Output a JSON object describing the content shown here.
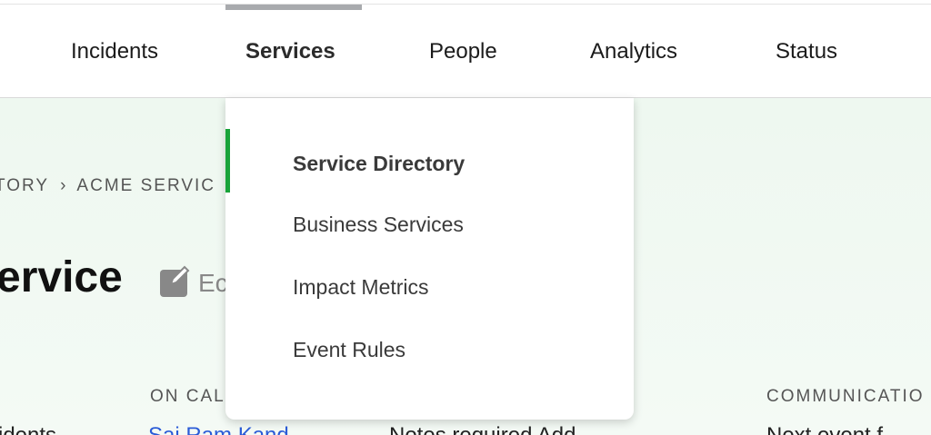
{
  "nav": {
    "items": [
      {
        "label": "Incidents"
      },
      {
        "label": "Services"
      },
      {
        "label": "People"
      },
      {
        "label": "Analytics"
      },
      {
        "label": "Status"
      }
    ],
    "active": "Services"
  },
  "dropdown": {
    "items": [
      {
        "label": "Service Directory"
      },
      {
        "label": "Business Services"
      },
      {
        "label": "Impact Metrics"
      },
      {
        "label": "Event Rules"
      }
    ],
    "active": "Service Directory"
  },
  "page": {
    "breadcrumb": {
      "part1": "TORY",
      "separator": "›",
      "part2": "ACME SERVIC"
    },
    "title": "ervice",
    "edit_label": "Ec",
    "labels": {
      "on_call": "ON CAL",
      "communication": "COMMUNICATIO"
    },
    "row": {
      "left": "idents ",
      "link": "Sai Ram Kand",
      "middle": "Notes required Add",
      "right": "Next event f"
    }
  },
  "colors": {
    "accent": "#19a33a",
    "link": "#2a5bd7",
    "page_bg": "#f0f8f1"
  }
}
